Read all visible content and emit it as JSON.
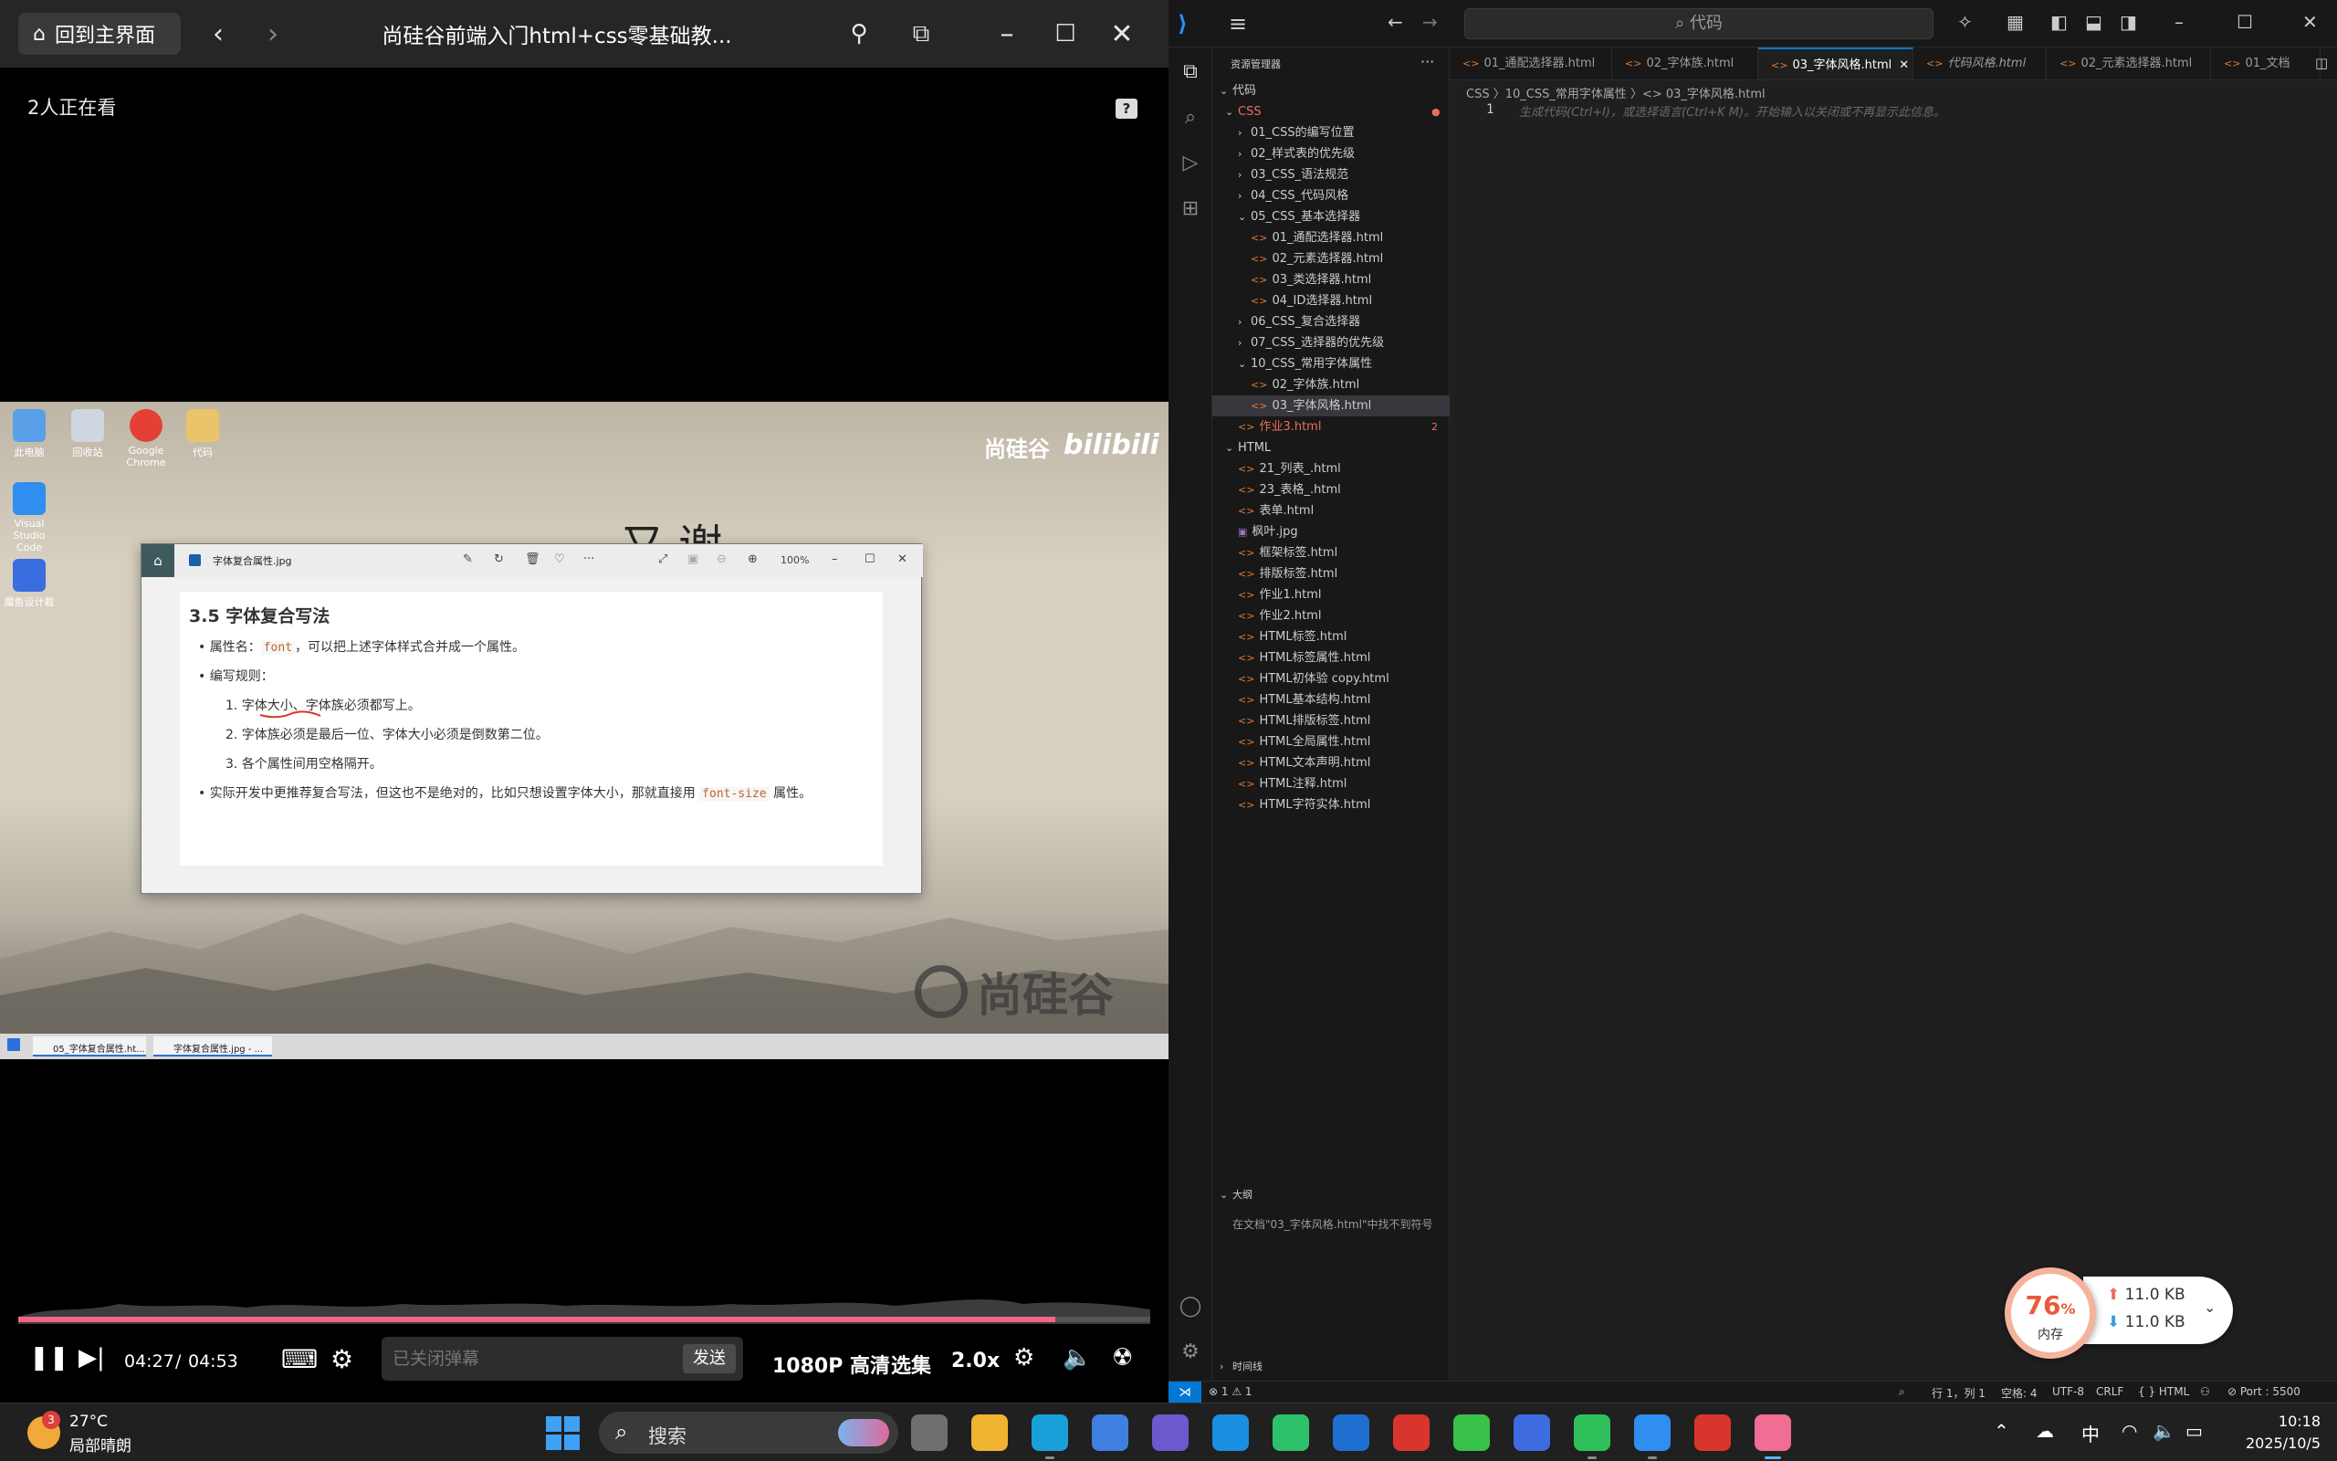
{
  "player": {
    "home_label": "回到主界面",
    "title": "尚硅谷前端入门html+css零基础教...",
    "watching": "2人正在看",
    "help_icon": "?",
    "time_current": "04:27",
    "time_sep": "/",
    "time_total": "04:53",
    "progress_fraction": 0.9164,
    "danmu_placeholder": "已关闭弹幕",
    "send_label": "发送",
    "quality": "1080P 高清",
    "episodes": "选集",
    "speed": "2.0x",
    "colors": {
      "progress": "#f16585"
    }
  },
  "video": {
    "desktop_icons": [
      {
        "label": "此电脑",
        "color": "#5aa0e8"
      },
      {
        "label": "回收站",
        "color": "#cfd6df"
      },
      {
        "label": "Google Chrome",
        "color": "#e44134"
      },
      {
        "label": "代码",
        "color": "#e9c46a"
      },
      {
        "label": "Visual Studio Code",
        "color": "#2f8ef0"
      },
      {
        "label": "魔鱼设计截",
        "color": "#3a6de0"
      }
    ],
    "watermark_text": "尚硅谷",
    "watermark_logo": "bilibili",
    "brand_logo": "尚硅谷",
    "bg_heading": "又 谢",
    "viewer": {
      "title": "字体复合属性.jpg",
      "zoom": "100%",
      "section_title": "3.5 字体复合写法",
      "b1_pre": "属性名：",
      "b1_code": "font",
      "b1_post": "，可以把上述字体样式合并成一个属性。",
      "b2": "编写规则：",
      "r1": "1.  字体大小、字体族必须都写上。",
      "r2": "2.  字体族必须是最后一位、字体大小必须是倒数第二位。",
      "r3": "3.  各个属性间用空格隔开。",
      "b3_pre": "实际开发中更推荐复合写法，但这也不是绝对的，比如只想设置字体大小，那就直接用 ",
      "b3_code": "font-size",
      "b3_post": " 属性。"
    },
    "inner_taskbar": [
      "05_字体复合属性.ht...",
      "字体复合属性.jpg - ..."
    ]
  },
  "vscode": {
    "search": "代码",
    "explorer_title": "资源管理器",
    "root": "代码",
    "tree": [
      {
        "label": "CSS",
        "indent": 0,
        "kind": "folder-open",
        "color": "#e8705c",
        "badge": "●"
      },
      {
        "label": "01_CSS的编写位置",
        "indent": 1,
        "kind": "folder"
      },
      {
        "label": "02_样式表的优先级",
        "indent": 1,
        "kind": "folder"
      },
      {
        "label": "03_CSS_语法规范",
        "indent": 1,
        "kind": "folder"
      },
      {
        "label": "04_CSS_代码风格",
        "indent": 1,
        "kind": "folder"
      },
      {
        "label": "05_CSS_基本选择器",
        "indent": 1,
        "kind": "folder-open"
      },
      {
        "label": "01_通配选择器.html",
        "indent": 2,
        "kind": "html"
      },
      {
        "label": "02_元素选择器.html",
        "indent": 2,
        "kind": "html"
      },
      {
        "label": "03_类选择器.html",
        "indent": 2,
        "kind": "html"
      },
      {
        "label": "04_ID选择器.html",
        "indent": 2,
        "kind": "html"
      },
      {
        "label": "06_CSS_复合选择器",
        "indent": 1,
        "kind": "folder"
      },
      {
        "label": "07_CSS_选择器的优先级",
        "indent": 1,
        "kind": "folder"
      },
      {
        "label": "10_CSS_常用字体属性",
        "indent": 1,
        "kind": "folder-open"
      },
      {
        "label": "02_字体族.html",
        "indent": 2,
        "kind": "html"
      },
      {
        "label": "03_字体风格.html",
        "indent": 2,
        "kind": "html",
        "selected": true
      },
      {
        "label": "作业3.html",
        "indent": 1,
        "kind": "html",
        "color": "#e8705c",
        "badge": "2"
      },
      {
        "label": "HTML",
        "indent": 0,
        "kind": "folder-open"
      },
      {
        "label": "21_列表_.html",
        "indent": 1,
        "kind": "html"
      },
      {
        "label": "23_表格_.html",
        "indent": 1,
        "kind": "html"
      },
      {
        "label": "表单.html",
        "indent": 1,
        "kind": "html"
      },
      {
        "label": "枫叶.jpg",
        "indent": 1,
        "kind": "image"
      },
      {
        "label": "框架标签.html",
        "indent": 1,
        "kind": "html"
      },
      {
        "label": "排版标签.html",
        "indent": 1,
        "kind": "html"
      },
      {
        "label": "作业1.html",
        "indent": 1,
        "kind": "html"
      },
      {
        "label": "作业2.html",
        "indent": 1,
        "kind": "html"
      },
      {
        "label": "HTML标签.html",
        "indent": 1,
        "kind": "html"
      },
      {
        "label": "HTML标签属性.html",
        "indent": 1,
        "kind": "html"
      },
      {
        "label": "HTML初体验 copy.html",
        "indent": 1,
        "kind": "html"
      },
      {
        "label": "HTML基本结构.html",
        "indent": 1,
        "kind": "html"
      },
      {
        "label": "HTML排版标签.html",
        "indent": 1,
        "kind": "html"
      },
      {
        "label": "HTML全局属性.html",
        "indent": 1,
        "kind": "html"
      },
      {
        "label": "HTML文本声明.html",
        "indent": 1,
        "kind": "html"
      },
      {
        "label": "HTML注释.html",
        "indent": 1,
        "kind": "html"
      },
      {
        "label": "HTML字符实体.html",
        "indent": 1,
        "kind": "html"
      }
    ],
    "outline_title": "大纲",
    "outline_msg": "在文档\"03_字体风格.html\"中找不到符号",
    "timeline_title": "时间线",
    "tabs": [
      {
        "label": "01_通配选择器.html"
      },
      {
        "label": "02_字体族.html"
      },
      {
        "label": "03_字体风格.html",
        "active": true,
        "close": "✕"
      },
      {
        "label": "代码风格.html",
        "italic": true
      },
      {
        "label": "02_元素选择器.html"
      },
      {
        "label": "01_文档"
      }
    ],
    "breadcrumb": "CSS 〉10_CSS_常用字体属性 〉<> 03_字体风格.html",
    "line_number": "1",
    "hint": "生成代码(Ctrl+I)，或选择语言(Ctrl+K M)。开始输入以关闭或不再显示此信息。",
    "status": {
      "errors": "⊗ 1 ⚠ 1",
      "position": "行 1，列 1",
      "spaces": "空格: 4",
      "encoding": "UTF-8",
      "eol": "CRLF",
      "lang": "{ } HTML",
      "port": "⊘ Port : 5500"
    }
  },
  "memory": {
    "percent": "76",
    "unit": "%",
    "label": "内存",
    "up": "11.0 KB",
    "down": "11.0 KB"
  },
  "taskbar": {
    "badge": "3",
    "temp": "27°C",
    "weather": "局部晴朗",
    "search": "搜索",
    "ime": "中",
    "time": "10:18",
    "date": "2025/10/5",
    "apps": [
      {
        "name": "task-view",
        "color": "#6f6f6f"
      },
      {
        "name": "file-explorer",
        "color": "#f0b431"
      },
      {
        "name": "edge",
        "color": "#1aa0d8"
      },
      {
        "name": "store",
        "color": "#3f7fe0"
      },
      {
        "name": "copilot-app",
        "color": "#6a5acd"
      },
      {
        "name": "edge-ai",
        "color": "#1a8ee0"
      },
      {
        "name": "bookmark-app",
        "color": "#2ec16b"
      },
      {
        "name": "outlook",
        "color": "#1f6fd0"
      },
      {
        "name": "wps",
        "color": "#d8362c"
      },
      {
        "name": "iqiyi",
        "color": "#39c24a"
      },
      {
        "name": "bag-app",
        "color": "#3e6be0"
      },
      {
        "name": "wechat",
        "color": "#2fc05b"
      },
      {
        "name": "vscode-app",
        "color": "#2f8ef0"
      },
      {
        "name": "wps-2",
        "color": "#d8362c"
      },
      {
        "name": "bilibili-app",
        "color": "#f06d94"
      }
    ]
  }
}
